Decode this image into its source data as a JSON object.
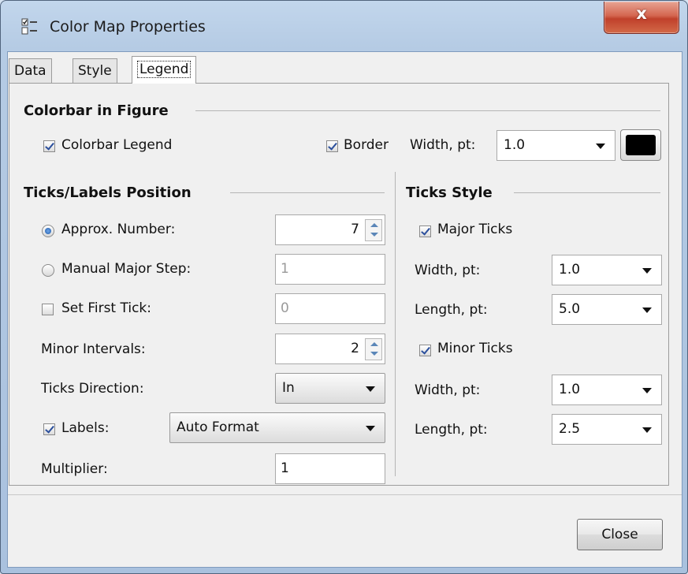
{
  "window": {
    "title": "Color Map Properties",
    "close_glyph": "x"
  },
  "tabs": [
    "Data",
    "Style",
    "Legend"
  ],
  "active_tab": "Legend",
  "colorbar": {
    "heading": "Colorbar in Figure",
    "legend_label": "Colorbar Legend",
    "legend_checked": true,
    "border_label": "Border",
    "border_checked": true,
    "width_label": "Width, pt:",
    "width_value": "1.0",
    "border_color": "#000000"
  },
  "ticks_position": {
    "heading": "Ticks/Labels Position",
    "approx_label": "Approx. Number:",
    "approx_value": "7",
    "approx_selected": true,
    "manual_label": "Manual Major Step:",
    "manual_value": "1",
    "first_tick_label": "Set First Tick:",
    "first_tick_value": "0",
    "first_tick_checked": false,
    "minor_label": "Minor Intervals:",
    "minor_value": "2",
    "direction_label": "Ticks Direction:",
    "direction_value": "In",
    "labels_label": "Labels:",
    "labels_checked": true,
    "labels_format": "Auto Format",
    "multiplier_label": "Multiplier:",
    "multiplier_value": "1"
  },
  "ticks_style": {
    "heading": "Ticks Style",
    "major_label": "Major Ticks",
    "major_checked": true,
    "major_width_label": "Width, pt:",
    "major_width_value": "1.0",
    "major_length_label": "Length, pt:",
    "major_length_value": "5.0",
    "minor_label": "Minor Ticks",
    "minor_checked": true,
    "minor_width_label": "Width, pt:",
    "minor_width_value": "1.0",
    "minor_length_label": "Length, pt:",
    "minor_length_value": "2.5"
  },
  "footer": {
    "close_label": "Close"
  }
}
